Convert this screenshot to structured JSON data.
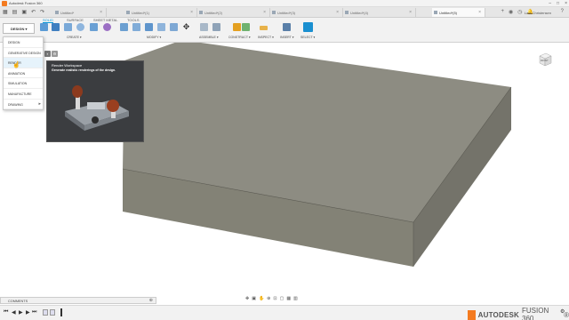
{
  "titlebar": {
    "title": "Autodesk Fusion 360"
  },
  "tabs": [
    {
      "label": "Untitled*"
    },
    {
      "label": "Untitled*(1)"
    },
    {
      "label": "Untitled*(2)"
    },
    {
      "label": "Untitled*(3)"
    },
    {
      "label": "Untitled*(4)"
    },
    {
      "label": "Untitled*(5)"
    }
  ],
  "user": {
    "name": "Lars Christensen"
  },
  "toolbar": {
    "workspace_label": "DESIGN",
    "context_tabs": [
      "SOLID",
      "SURFACE",
      "SHEET METAL",
      "TOOLS"
    ],
    "groups": [
      "CREATE",
      "MODIFY",
      "ASSEMBLE",
      "CONSTRUCT",
      "INSPECT",
      "INSERT",
      "SELECT"
    ]
  },
  "workspace_menu": {
    "items": [
      {
        "label": "DESIGN"
      },
      {
        "label": "GENERATIVE DESIGN"
      },
      {
        "label": "RENDER"
      },
      {
        "label": "ANIMATION"
      },
      {
        "label": "SIMULATION"
      },
      {
        "label": "MANUFACTURE"
      },
      {
        "label": "DRAWING"
      }
    ]
  },
  "tooltip": {
    "title": "Render Workspace",
    "description": "Generate realistic renderings of the design."
  },
  "comments": {
    "label": "COMMENTS"
  },
  "brand": {
    "autodesk": "AUTODESK",
    "fusion": "FUSION 360",
    "version_mark": "®"
  },
  "colors": {
    "accent": "#0696d7",
    "brand_orange": "#f47b20",
    "slab_top": "#8d8c82",
    "slab_side": "#74736a"
  }
}
